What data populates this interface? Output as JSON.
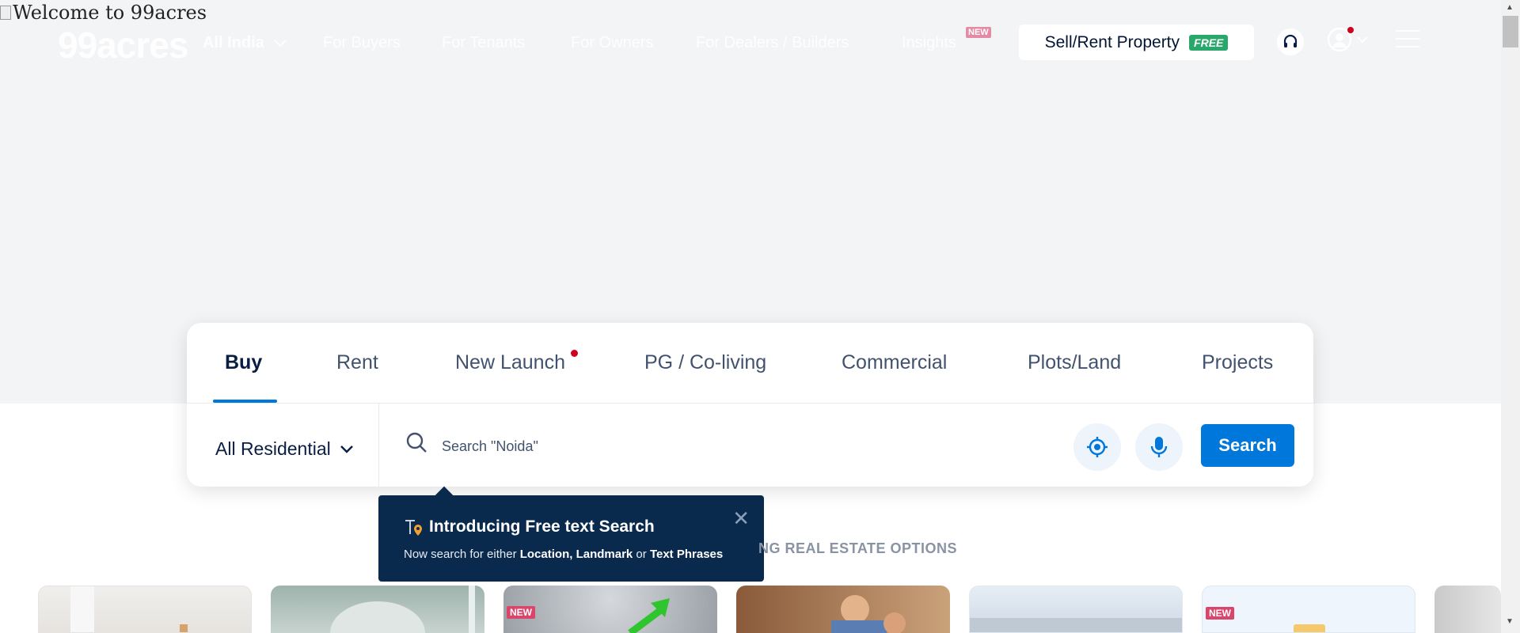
{
  "hero": {
    "alt_text": "Welcome to 99acres"
  },
  "header": {
    "logo": "99acres",
    "city": "All India",
    "nav": [
      "For Buyers",
      "For Tenants",
      "For Owners",
      "For Dealers / Builders",
      "Insights"
    ],
    "insights_badge": "NEW",
    "sell_label": "Sell/Rent Property",
    "sell_badge": "FREE"
  },
  "search": {
    "tabs": [
      "Buy",
      "Rent",
      "New Launch",
      "PG / Co-living",
      "Commercial",
      "Plots/Land",
      "Projects"
    ],
    "active_tab": "Buy",
    "property_type": "All Residential",
    "placeholder": "Search \"Noida\"",
    "button": "Search"
  },
  "tooltip": {
    "title": "Introducing Free text Search",
    "desc_prefix": "Now search for either ",
    "desc_bold1": "Location, Landmark",
    "desc_mid": " or ",
    "desc_bold2": "Text Phrases"
  },
  "section": {
    "heading": "NG REAL ESTATE OPTIONS"
  },
  "cards": [
    {
      "badge": ""
    },
    {
      "badge": ""
    },
    {
      "badge": "NEW"
    },
    {
      "badge": ""
    },
    {
      "badge": ""
    },
    {
      "badge": "NEW"
    },
    {
      "badge": ""
    }
  ],
  "colors": {
    "brand": "#0078db",
    "free": "#2aa86b",
    "tooltip": "#0a2a4d",
    "alert": "#d0021b"
  }
}
